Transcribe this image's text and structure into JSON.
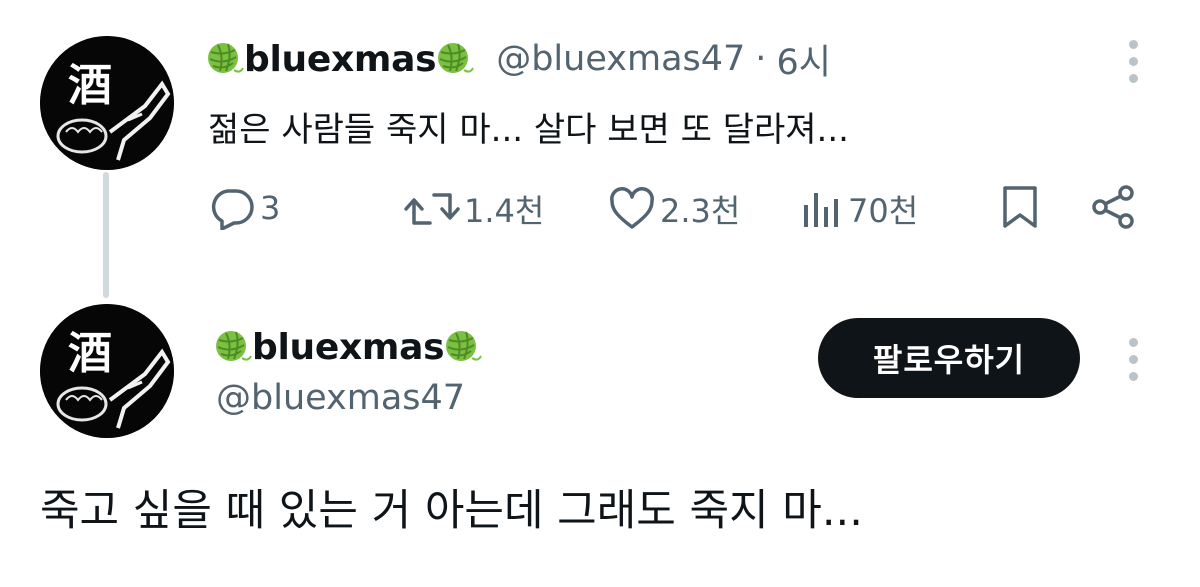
{
  "reply_tweet": {
    "display_name": "bluexmas",
    "handle": "@bluexmas47",
    "separator": "·",
    "time": "6시",
    "text": "젊은 사람들 죽지 마... 살다 보면 또 달라져...",
    "metrics": {
      "replies": "3",
      "reposts": "1.4천",
      "likes": "2.3천",
      "views": "70천"
    },
    "avatar_glyph": "酒"
  },
  "main_tweet": {
    "display_name": "bluexmas",
    "handle": "@bluexmas47",
    "follow_label": "팔로우하기",
    "text": "죽고 싶을 때 있는 거 아는데 그래도 죽지 마...",
    "avatar_glyph": "酒"
  },
  "icons": {
    "name_emoji": "yarn-ball-icon",
    "reply": "speech-bubble-icon",
    "repost": "repost-arrows-icon",
    "like": "heart-icon",
    "views": "bar-chart-icon",
    "bookmark": "bookmark-icon",
    "share": "share-icon",
    "more": "kebab-icon"
  },
  "colors": {
    "text_primary": "#0f1419",
    "text_secondary": "#536471",
    "thread_line": "#cfd9de",
    "follow_button_bg": "#0f1419",
    "yarn_green": "#7ac142"
  }
}
